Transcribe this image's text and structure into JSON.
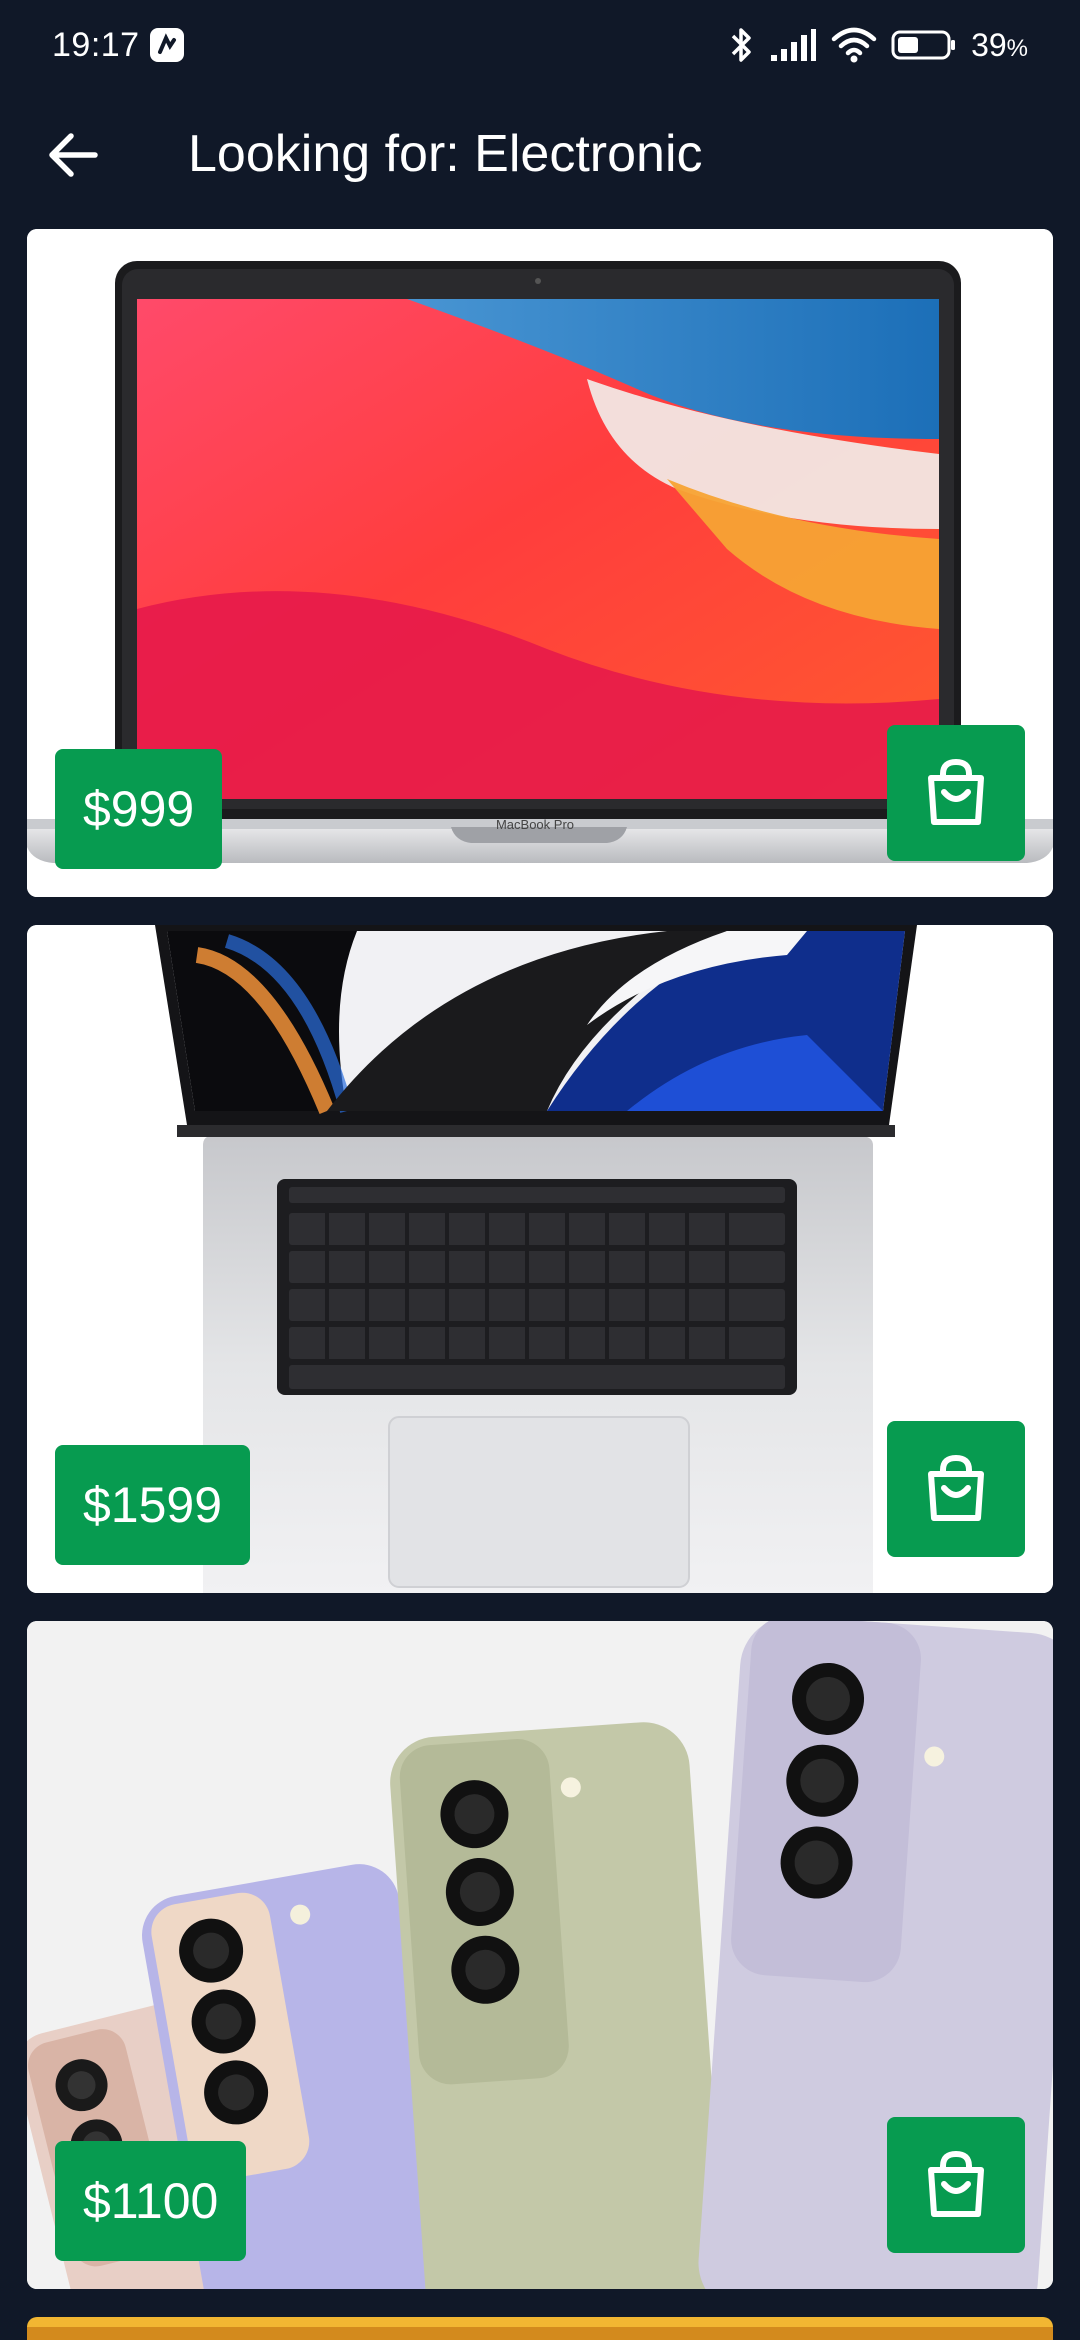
{
  "status_bar": {
    "time": "19:17",
    "battery_percent": "39",
    "battery_unit": "%",
    "icons": [
      "app-notification-icon",
      "bluetooth-icon",
      "signal-icon",
      "wifi-icon",
      "battery-icon"
    ]
  },
  "header": {
    "back_icon": "arrow-left-icon",
    "title": "Looking for: Electronic"
  },
  "products": [
    {
      "price": "$999",
      "image": "laptop-silver-front-view",
      "cart_icon": "shopping-bag-icon",
      "screen_label": "MacBook Pro"
    },
    {
      "price": "$1599",
      "image": "laptop-open-keyboard-top-view",
      "cart_icon": "shopping-bag-icon"
    },
    {
      "price": "$1100",
      "image": "smartphones-back-view-fan",
      "cart_icon": "shopping-bag-icon"
    }
  ],
  "colors": {
    "background": "#101828",
    "card": "#ffffff",
    "accent_green": "#079b50",
    "text_light": "#ffffff"
  }
}
